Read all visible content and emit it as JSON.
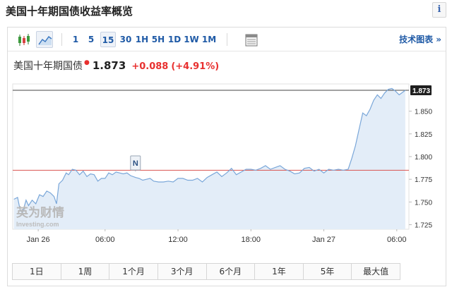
{
  "page": {
    "title": "美国十年期国债收益率概览",
    "info_glyph": "i"
  },
  "toolbar": {
    "intervals": [
      "1",
      "5",
      "15",
      "30",
      "1H",
      "5H",
      "1D",
      "1W",
      "1M"
    ],
    "active_interval": "15",
    "tech_chart_label": "技术图表 »"
  },
  "quote": {
    "name": "美国十年期国债",
    "price": "1.873",
    "change": "+0.088",
    "change_pct": "(+4.91%)"
  },
  "watermark": {
    "brand": "英为财情",
    "sub": "Investing.com"
  },
  "marker_label": "N",
  "ranges": [
    "1日",
    "1周",
    "1个月",
    "3个月",
    "6个月",
    "1年",
    "5年",
    "最大值"
  ],
  "colors": {
    "accent": "#1f5aa6",
    "up": "#e8302f",
    "line": "#7aa7d9",
    "fill": "#e3edf8",
    "ref_line": "#d9534f"
  },
  "chart_data": {
    "type": "area",
    "title": "",
    "xlabel": "",
    "ylabel": "",
    "ylim": [
      1.72,
      1.88
    ],
    "x_ticks": [
      {
        "label": "Jan 26",
        "x": 0.5
      },
      {
        "label": "06:00",
        "x": 6
      },
      {
        "label": "12:00",
        "x": 12
      },
      {
        "label": "18:00",
        "x": 18
      },
      {
        "label": "Jan 27",
        "x": 24
      },
      {
        "label": "06:00",
        "x": 30
      }
    ],
    "y_ticks": [
      1.725,
      1.75,
      1.775,
      1.8,
      1.825,
      1.85
    ],
    "last_value": 1.873,
    "reference_value": 1.785,
    "marker_x": 8.5,
    "series": [
      {
        "x": [
          -1.5,
          -1.2,
          -1.0,
          -0.8,
          -0.5,
          -0.3,
          0.0,
          0.3,
          0.6,
          0.9,
          1.2,
          1.5,
          1.8,
          2.0,
          2.2,
          2.5,
          2.8,
          3.0,
          3.3,
          3.6,
          3.9,
          4.2,
          4.5,
          4.8,
          5.1,
          5.4,
          5.7,
          6.0,
          6.3,
          6.6,
          6.9,
          7.2,
          7.5,
          7.8,
          8.1,
          8.5,
          8.8,
          9.1,
          9.4,
          9.7,
          10.0,
          10.4,
          10.8,
          11.2,
          11.6,
          12.0,
          12.4,
          12.8,
          13.2,
          13.6,
          14.0,
          14.4,
          14.8,
          15.2,
          15.6,
          16.0,
          16.4,
          16.8,
          17.2,
          17.6,
          18.0,
          18.4,
          18.8,
          19.2,
          19.6,
          20.0,
          20.4,
          20.8,
          21.2,
          21.6,
          22.0,
          22.4,
          22.8,
          23.2,
          23.6,
          24.0,
          24.4,
          24.8,
          25.2,
          25.6,
          26.0,
          26.3,
          26.6,
          26.9,
          27.2,
          27.5,
          27.8,
          28.1,
          28.4,
          28.7,
          29.0,
          29.3,
          29.6,
          29.9,
          30.2,
          30.5,
          30.7
        ],
        "y": [
          1.753,
          1.755,
          1.742,
          1.738,
          1.752,
          1.746,
          1.752,
          1.748,
          1.758,
          1.756,
          1.762,
          1.76,
          1.756,
          1.748,
          1.77,
          1.774,
          1.782,
          1.78,
          1.786,
          1.785,
          1.78,
          1.784,
          1.778,
          1.781,
          1.78,
          1.773,
          1.776,
          1.776,
          1.782,
          1.78,
          1.783,
          1.782,
          1.781,
          1.782,
          1.779,
          1.777,
          1.776,
          1.774,
          1.775,
          1.776,
          1.773,
          1.772,
          1.772,
          1.773,
          1.772,
          1.776,
          1.776,
          1.774,
          1.774,
          1.776,
          1.772,
          1.777,
          1.78,
          1.783,
          1.778,
          1.782,
          1.787,
          1.78,
          1.783,
          1.786,
          1.786,
          1.785,
          1.787,
          1.79,
          1.786,
          1.788,
          1.79,
          1.786,
          1.784,
          1.781,
          1.782,
          1.787,
          1.788,
          1.784,
          1.786,
          1.782,
          1.786,
          1.785,
          1.786,
          1.785,
          1.786,
          1.798,
          1.812,
          1.83,
          1.848,
          1.845,
          1.852,
          1.862,
          1.868,
          1.864,
          1.87,
          1.874,
          1.875,
          1.872,
          1.868,
          1.871,
          1.873
        ]
      }
    ]
  }
}
